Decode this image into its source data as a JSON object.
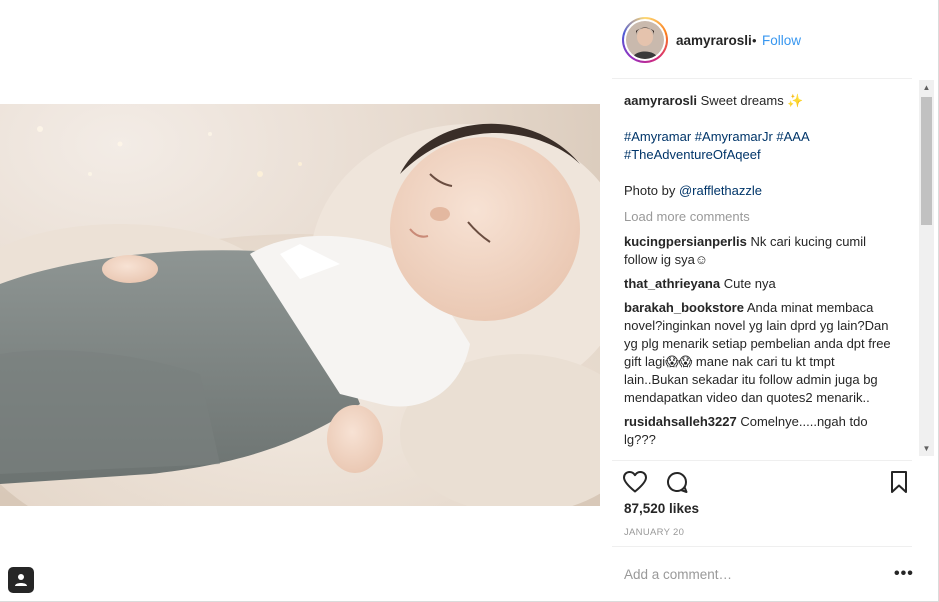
{
  "post": {
    "username": "aamyrarosli",
    "separator": "•",
    "follow_label": "Follow",
    "photo_alt": "Sleeping baby on fluffy blanket"
  },
  "caption": {
    "username": "aamyrarosli",
    "text": "Sweet dreams",
    "emoji": "✨",
    "hashtags_line1": "#Amyramar #AmyramarJr #AAA",
    "hashtags_line2": "#TheAdventureOfAqeef",
    "photo_by_label": "Photo by",
    "photo_by_handle": "@rafflethazzle"
  },
  "load_more_label": "Load more comments",
  "comments": [
    {
      "user": "kucingpersianperlis",
      "text": "Nk cari kucing cumil follow ig sya☺"
    },
    {
      "user": "that_athrieyana",
      "text": "Cute nya"
    },
    {
      "user": "barakah_bookstore",
      "text": "Anda minat membaca novel?inginkan novel yg lain dprd yg lain?Dan yg plg menarik setiap pembelian anda dpt free gift lagi😱😱 mane nak cari tu kt tmpt lain..Bukan sekadar itu follow admin juga bg mendapatkan video dan quotes2 menarik.."
    },
    {
      "user": "rusidahsalleh3227",
      "text": "Comelnye.....ngah tdo lg???"
    }
  ],
  "actions": {
    "like_icon": "heart-icon",
    "comment_icon": "speech-bubble-icon",
    "save_icon": "bookmark-icon"
  },
  "likes_label": "87,520 likes",
  "date_label": "JANUARY 20",
  "comment_box": {
    "placeholder": "Add a comment…",
    "more_label": "•••"
  },
  "colors": {
    "link_blue": "#3897f0",
    "hashtag_blue": "#003569",
    "muted_gray": "#999999",
    "text_dark": "#262626"
  }
}
